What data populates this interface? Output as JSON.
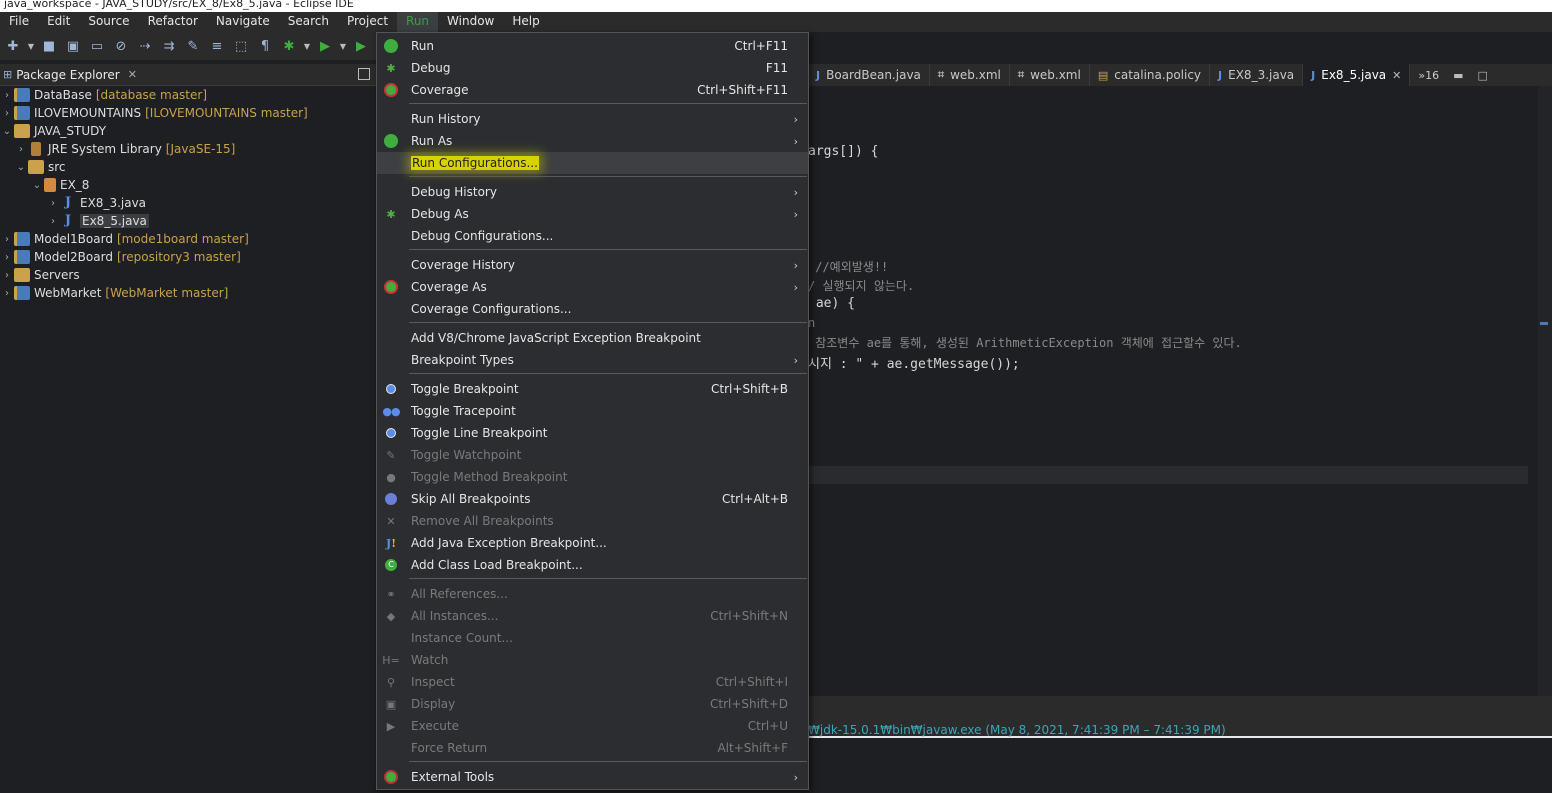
{
  "window": {
    "title": "java_workspace - JAVA_STUDY/src/EX_8/Ex8_5.java - Eclipse IDE"
  },
  "menubar": [
    "File",
    "Edit",
    "Source",
    "Refactor",
    "Navigate",
    "Search",
    "Project",
    "Run",
    "Window",
    "Help"
  ],
  "menubar_active": "Run",
  "package_explorer": {
    "title": "Package Explorer",
    "close": "✕",
    "tree": [
      {
        "label": "DataBase",
        "deco": "[database master]"
      },
      {
        "label": "ILOVEMOUNTAINS",
        "deco": "[ILOVEMOUNTAINS master]"
      },
      {
        "label": "JAVA_STUDY",
        "deco": ""
      },
      {
        "label": "JRE System Library",
        "deco": "[JavaSE-15]"
      },
      {
        "label": "src",
        "deco": ""
      },
      {
        "label": "EX_8",
        "deco": ""
      },
      {
        "label": "EX8_3.java",
        "deco": ""
      },
      {
        "label": "Ex8_5.java",
        "deco": ""
      },
      {
        "label": "Model1Board",
        "deco": "[mode1board master]"
      },
      {
        "label": "Model2Board",
        "deco": "[repository3 master]"
      },
      {
        "label": "Servers",
        "deco": ""
      },
      {
        "label": "WebMarket",
        "deco": "[WebMarket master]"
      }
    ]
  },
  "editor_tabs": [
    {
      "label": "BoardBean.java",
      "icon": "J"
    },
    {
      "label": "web.xml",
      "icon": "x"
    },
    {
      "label": "web.xml",
      "icon": "x"
    },
    {
      "label": "catalina.policy",
      "icon": "p"
    },
    {
      "label": "EX8_3.java",
      "icon": "J"
    },
    {
      "label": "Ex8_5.java",
      "icon": "J",
      "close": "✕"
    }
  ],
  "tabs_more": "»16",
  "code_lines": {
    "l1": "args[]) {",
    "l2": " //예외발생!!",
    "l3": "/ 실행되지 않는다.",
    "l4": " ae) {",
    "l5": "n",
    "l6": " 참조변수 ae를 통해, 생성된 ArithmeticException 객체에 접근할수 있다.",
    "l7": "시지 : \" + ae.getMessage());"
  },
  "console": {
    "text": "₩jdk-15.0.1₩bin₩javaw.exe  (May 8, 2021, 7:41:39 PM – 7:41:39 PM)"
  },
  "run_menu": {
    "items": [
      {
        "label": "Run",
        "shortcut": "Ctrl+F11"
      },
      {
        "label": "Debug",
        "shortcut": "F11"
      },
      {
        "label": "Coverage",
        "shortcut": "Ctrl+Shift+F11"
      },
      {
        "label": "Run History",
        "submenu": "›"
      },
      {
        "label": "Run As",
        "submenu": "›"
      },
      {
        "label": "Run Configurations..."
      },
      {
        "label": "Debug History",
        "submenu": "›"
      },
      {
        "label": "Debug As",
        "submenu": "›"
      },
      {
        "label": "Debug Configurations..."
      },
      {
        "label": "Coverage History",
        "submenu": "›"
      },
      {
        "label": "Coverage As",
        "submenu": "›"
      },
      {
        "label": "Coverage Configurations..."
      },
      {
        "label": "Add V8/Chrome JavaScript Exception Breakpoint"
      },
      {
        "label": "Breakpoint Types",
        "submenu": "›"
      },
      {
        "label": "Toggle Breakpoint",
        "shortcut": "Ctrl+Shift+B"
      },
      {
        "label": "Toggle Tracepoint"
      },
      {
        "label": "Toggle Line Breakpoint"
      },
      {
        "label": "Toggle Watchpoint"
      },
      {
        "label": "Toggle Method Breakpoint"
      },
      {
        "label": "Skip All Breakpoints",
        "shortcut": "Ctrl+Alt+B"
      },
      {
        "label": "Remove All Breakpoints"
      },
      {
        "label": "Add Java Exception Breakpoint..."
      },
      {
        "label": "Add Class Load Breakpoint..."
      },
      {
        "label": "All References..."
      },
      {
        "label": "All Instances...",
        "shortcut": "Ctrl+Shift+N"
      },
      {
        "label": "Instance Count..."
      },
      {
        "label": "Watch"
      },
      {
        "label": "Inspect",
        "shortcut": "Ctrl+Shift+I"
      },
      {
        "label": "Display",
        "shortcut": "Ctrl+Shift+D"
      },
      {
        "label": "Execute",
        "shortcut": "Ctrl+U"
      },
      {
        "label": "Force Return",
        "shortcut": "Alt+Shift+F"
      },
      {
        "label": "External Tools",
        "submenu": "›"
      }
    ]
  },
  "colors": {
    "highlight": "#d7d300",
    "run_green": "#3fae3f",
    "decoration": "#c8a24a",
    "console_link": "#3aa6b9"
  }
}
